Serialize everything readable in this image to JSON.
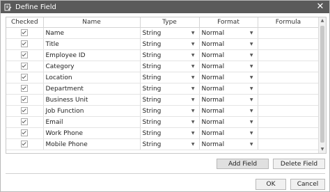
{
  "window": {
    "title": "Define Field",
    "close_glyph": "✕"
  },
  "table": {
    "columns": [
      "Checked",
      "Name",
      "Type",
      "Format",
      "Formula"
    ],
    "rows": [
      {
        "checked": true,
        "name": "Name",
        "type": "String",
        "format": "Normal",
        "formula": ""
      },
      {
        "checked": true,
        "name": "Title",
        "type": "String",
        "format": "Normal",
        "formula": ""
      },
      {
        "checked": true,
        "name": "Employee ID",
        "type": "String",
        "format": "Normal",
        "formula": ""
      },
      {
        "checked": true,
        "name": "Category",
        "type": "String",
        "format": "Normal",
        "formula": ""
      },
      {
        "checked": true,
        "name": "Location",
        "type": "String",
        "format": "Normal",
        "formula": ""
      },
      {
        "checked": true,
        "name": "Department",
        "type": "String",
        "format": "Normal",
        "formula": ""
      },
      {
        "checked": true,
        "name": "Business Unit",
        "type": "String",
        "format": "Normal",
        "formula": ""
      },
      {
        "checked": true,
        "name": "Job Function",
        "type": "String",
        "format": "Normal",
        "formula": ""
      },
      {
        "checked": true,
        "name": "Email",
        "type": "String",
        "format": "Normal",
        "formula": ""
      },
      {
        "checked": true,
        "name": "Work Phone",
        "type": "String",
        "format": "Normal",
        "formula": ""
      },
      {
        "checked": true,
        "name": "Mobile Phone",
        "type": "String",
        "format": "Normal",
        "formula": ""
      }
    ]
  },
  "buttons": {
    "add_field": "Add Field",
    "delete_field": "Delete Field",
    "ok": "OK",
    "cancel": "Cancel"
  },
  "icons": {
    "app": "define-field-icon",
    "dropdown": "▼",
    "scroll_up": "▲",
    "scroll_down": "▼"
  }
}
